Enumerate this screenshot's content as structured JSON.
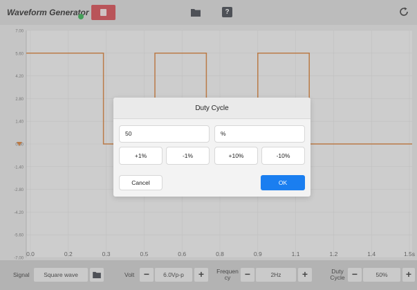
{
  "app": {
    "title": "Waveform Generator"
  },
  "toolbar": {
    "stop_icon": "stop-icon",
    "folder_icon": "folder-icon",
    "help_label": "?",
    "refresh_icon": "refresh-icon"
  },
  "chart_data": {
    "type": "line",
    "series": [
      {
        "x": [
          0,
          0.1,
          0.1,
          0.3,
          0.3,
          0.5,
          0.5,
          0.7,
          0.7,
          0.9,
          0.9,
          1.1,
          1.1,
          1.3,
          1.3,
          1.5
        ],
        "y": [
          5.6,
          5.6,
          5.6,
          5.6,
          0,
          0,
          5.6,
          5.6,
          0,
          0,
          5.6,
          5.6,
          0,
          0,
          0,
          0
        ]
      }
    ],
    "x_ticks": [
      "0.0",
      "0.2",
      "0.3",
      "0.5",
      "0.6",
      "0.8",
      "0.9",
      "1.1",
      "1.2",
      "1.4",
      "1.5s"
    ],
    "y_ticks": [
      "7.00",
      "5.60",
      "4.20",
      "2.80",
      "1.40",
      "0.00",
      "-1.40",
      "-2.80",
      "-4.20",
      "-5.60",
      "-7.00"
    ],
    "xlim": [
      0,
      1.5
    ],
    "ylim": [
      -7,
      7
    ],
    "grid": true,
    "color": "#d97b2e"
  },
  "dialog": {
    "title": "Duty Cycle",
    "value": "50",
    "unit": "%",
    "steps": [
      "+1%",
      "-1%",
      "+10%",
      "-10%"
    ],
    "cancel": "Cancel",
    "ok": "OK"
  },
  "bottom": {
    "signal_label": "Signal",
    "signal_value": "Square wave",
    "volt_label": "Volt",
    "volt_value": "6.0Vp-p",
    "freq_label_1": "Frequen",
    "freq_label_2": "cy",
    "freq_value": "2Hz",
    "duty_label_1": "Duty",
    "duty_label_2": "Cycle",
    "duty_value": "50%",
    "minus": "−",
    "plus": "+"
  }
}
